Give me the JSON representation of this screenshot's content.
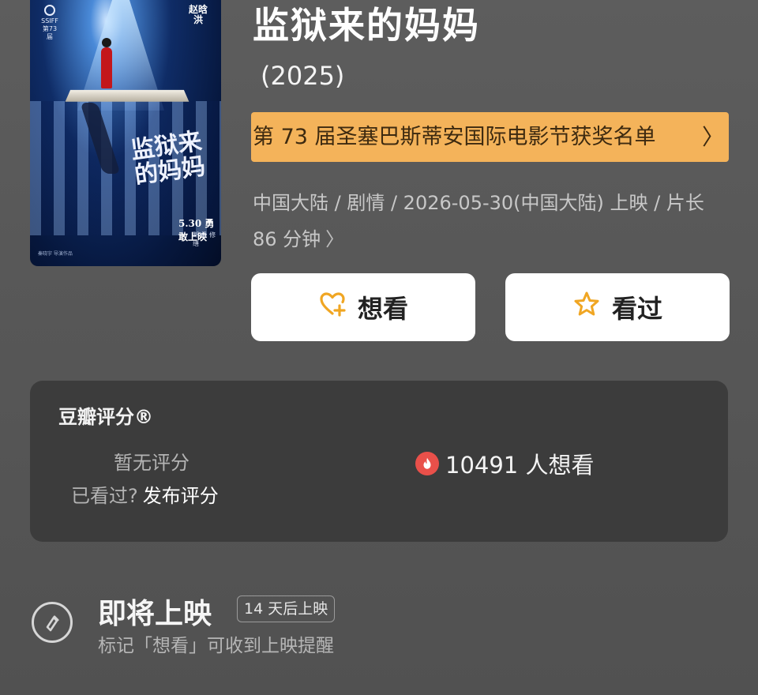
{
  "movie": {
    "title": "监狱来的妈妈",
    "year": "(2025)",
    "award_banner": "第 73 届圣塞巴斯蒂安国际电影节获奖名单",
    "meta": "中国大陆 / 剧情 / 2026-05-30(中国大陆) 上映 / 片长 86 分钟"
  },
  "poster": {
    "logo_text": "SSIFF 第73届",
    "director_text": "赵晗洪",
    "title_text": "监狱来的妈妈",
    "date_text": "5.30 勇敢上映",
    "sub_text": "断 极 修 缮",
    "credit_text": "秦晓宇 导演作品"
  },
  "actions": {
    "want_label": "想看",
    "seen_label": "看过"
  },
  "rating": {
    "title": "豆瓣评分®",
    "no_rating": "暂无评分",
    "seen_prompt": "已看过?",
    "publish_label": "发布评分",
    "want_count": "10491 人想看"
  },
  "upcoming": {
    "title": "即将上映",
    "badge": "14 天后上映",
    "subtitle": "标记「想看」可收到上映提醒"
  },
  "colors": {
    "background": "#575757",
    "award_bg": "#f4b35a",
    "icon_accent": "#f0a623",
    "fire": "#e9504a"
  }
}
